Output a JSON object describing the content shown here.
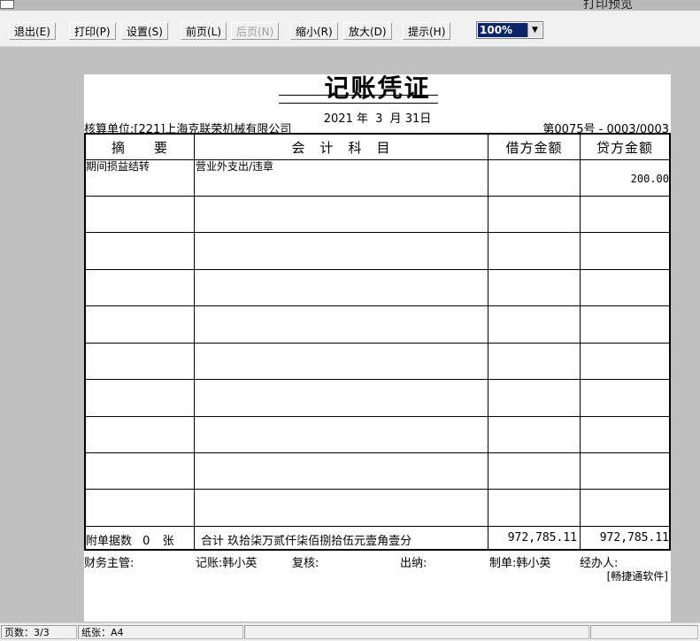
{
  "window": {
    "title": "打印预览"
  },
  "toolbar": {
    "exit": "退出(E)",
    "print": "打印(P)",
    "settings": "设置(S)",
    "prev": "前页(L)",
    "next": "后页(N)",
    "zoom_out": "缩小(R)",
    "zoom_in": "放大(D)",
    "hint": "提示(H)",
    "zoom_value": "100%"
  },
  "voucher": {
    "title": "记账凭证",
    "date_year": "2021",
    "date_year_label": "年",
    "date_month": "3",
    "date_month_label": "月",
    "date_day": "31",
    "date_day_label": "日",
    "unit": "核算单位:[221]上海克联荣机械有限公司",
    "number": "第0075号 - 0003/0003",
    "headers": {
      "summary": "摘　　要",
      "account": "会　计　科　目",
      "debit": "借方金额",
      "credit": "贷方金额"
    },
    "rows": [
      {
        "summary": "期间损益结转",
        "account": "营业外支出/违章",
        "debit": "",
        "credit": "200.00"
      }
    ],
    "attachments_label": "附单据数",
    "attachments_count": "0",
    "attachments_unit": "张",
    "total_text": "合计 玖拾柒万贰仟柒佰捌拾伍元壹角壹分",
    "total_debit": "972,785.11",
    "total_credit": "972,785.11",
    "signatures": {
      "finance_manager": "财务主管:",
      "bookkeeper": "记账:韩小英",
      "reviewer": "复核:",
      "cashier": "出纳:",
      "preparer": "制单:韩小英",
      "handler": "经办人:"
    },
    "software": "[畅捷通软件]"
  },
  "status": {
    "pages": "页数：3/3",
    "paper": "纸张：A4"
  }
}
